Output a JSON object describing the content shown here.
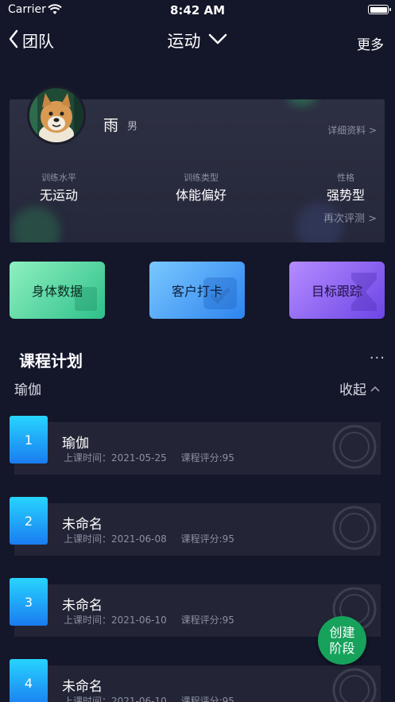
{
  "status_bar": {
    "carrier": "Carrier",
    "time": "8:42 AM"
  },
  "nav": {
    "back_label": "团队",
    "title": "运动",
    "more": "更多"
  },
  "profile": {
    "name": "雨",
    "gender": "男",
    "detail_link": "详细资料 >",
    "stats": [
      {
        "label": "训练水平",
        "value": "无运动"
      },
      {
        "label": "训练类型",
        "value": "体能偏好"
      },
      {
        "label": "性格",
        "value": "强势型"
      }
    ],
    "reassess_link": "再次评测 >"
  },
  "quick_actions": [
    {
      "label": "身体数据",
      "color_from": "#8ef0c0",
      "color_to": "#2fc08a"
    },
    {
      "label": "客户打卡",
      "color_from": "#79c8ff",
      "color_to": "#2e84ee"
    },
    {
      "label": "目标跟踪",
      "color_from": "#b58cff",
      "color_to": "#6c45e6"
    }
  ],
  "plan": {
    "title": "课程计划",
    "more": "···",
    "current": "瑜伽",
    "collapse_label": "收起"
  },
  "courses": [
    {
      "index": "1",
      "name": "瑜伽",
      "time": "上课时间：2021-05-25",
      "score": "课程评分:95"
    },
    {
      "index": "2",
      "name": "未命名",
      "time": "上课时间：2021-06-08",
      "score": "课程评分:95"
    },
    {
      "index": "3",
      "name": "未命名",
      "time": "上课时间：2021-06-10",
      "score": "课程评分:95"
    },
    {
      "index": "4",
      "name": "未命名",
      "time": "上课时间：2021-06-10",
      "score": "课程评分:95"
    }
  ],
  "fab": {
    "line1": "创建",
    "line2": "阶段"
  },
  "colors": {
    "background": "#14162a",
    "accent_green": "#17a25c",
    "number_badge": "#1a7cf0"
  },
  "icons": [
    "wifi-icon",
    "battery-icon",
    "back-chevron-icon",
    "chevron-down-icon",
    "chevron-up-icon",
    "stamp-icon"
  ]
}
